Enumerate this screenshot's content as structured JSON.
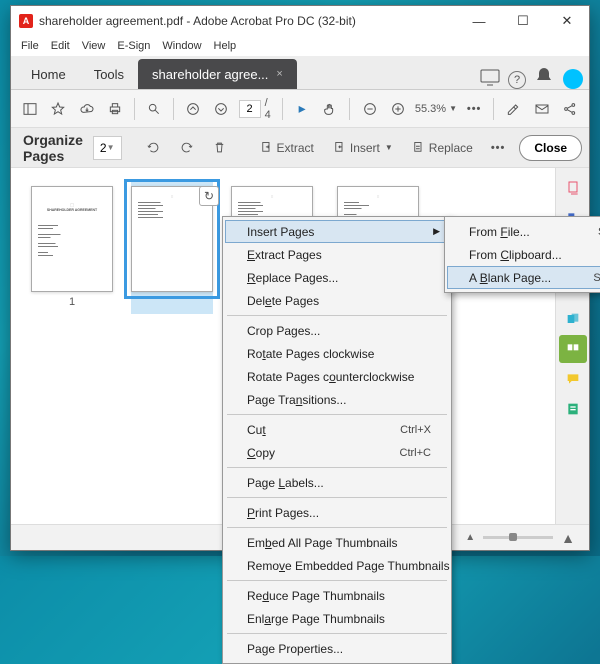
{
  "window": {
    "title": "shareholder agreement.pdf - Adobe Acrobat Pro DC (32-bit)"
  },
  "menubar": {
    "items": [
      "File",
      "Edit",
      "View",
      "E-Sign",
      "Window",
      "Help"
    ]
  },
  "tabs": {
    "home": "Home",
    "tools": "Tools",
    "doc": "shareholder agree...",
    "close": "×"
  },
  "toolbar": {
    "page_current": "2",
    "page_total": "/ 4",
    "zoom": "55.3%",
    "more": "•••"
  },
  "organize": {
    "title": "Organize Pages",
    "page": "2",
    "extract": "Extract",
    "insert": "Insert",
    "replace": "Replace",
    "more": "•••",
    "close": "Close"
  },
  "thumbs": {
    "p1": "1",
    "p2": "",
    "p3": "",
    "p4": ""
  },
  "ctx": {
    "insert_pages": "Insert Pages",
    "extract": "Extract Pages",
    "replace": "Replace Pages...",
    "delete": "Delete Pages",
    "crop": "Crop Pages...",
    "rotcw": "Rotate Pages clockwise",
    "rotccw": "Rotate Pages counterclockwise",
    "transitions": "Page Transitions...",
    "cut": "Cut",
    "cut_sc": "Ctrl+X",
    "copy": "Copy",
    "copy_sc": "Ctrl+C",
    "labels": "Page Labels...",
    "print": "Print Pages...",
    "embed": "Embed All Page Thumbnails",
    "remove": "Remove Embedded Page Thumbnails",
    "reduce": "Reduce Page Thumbnails",
    "enlarge": "Enlarge Page Thumbnails",
    "props": "Page Properties..."
  },
  "sub": {
    "from_file": "From File...",
    "from_file_sc": "Shift+Ctrl+I",
    "from_clipboard": "From Clipboard...",
    "blank": "A Blank Page...",
    "blank_sc": "Shift+Ctrl+T"
  }
}
